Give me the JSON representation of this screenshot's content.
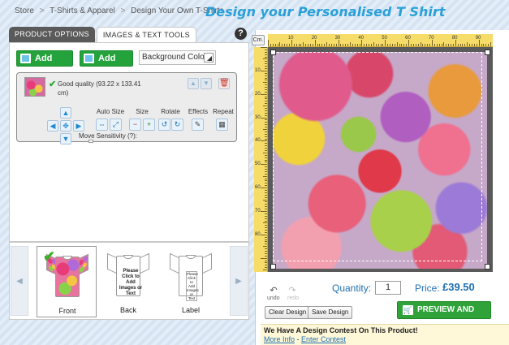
{
  "breadcrumb": {
    "items": [
      "Store",
      "T-Shirts & Apparel",
      "Design Your Own T-Shirts"
    ],
    "separator": ">"
  },
  "heading": "Design your Personalised T Shirt",
  "tabs": {
    "product_options": "PRODUCT OPTIONS",
    "images_text_tools": "IMAGES & TEXT TOOLS",
    "active": "IMAGES & TEXT TOOLS"
  },
  "help_label": "?",
  "toolbar": {
    "add_image": "Add Image",
    "add_text": "Add Text",
    "background_colour": "Background Colour"
  },
  "layer": {
    "quality_text": "Good quality (93.22 x 133.41 cm)",
    "check_glyph": "✔",
    "autosize_label": "Auto Size",
    "size_label": "Size",
    "rotate_label": "Rotate",
    "effects_label": "Effects",
    "repeat_label": "Repeat",
    "move_sensitivity": "Move Sensitivity (?):"
  },
  "views": {
    "front": "Front",
    "back": "Back",
    "label": "Label",
    "back_tee_text": "Please Click to Add Images or Text",
    "label_tee_text": "Please Click to Add Images or Text",
    "selected": "Front"
  },
  "canvas": {
    "unit_button": "Cm.",
    "ruler_top_labels": [
      "10",
      "20",
      "30",
      "40",
      "50",
      "60",
      "70",
      "80",
      "90"
    ],
    "ruler_left_labels": [
      "10",
      "20",
      "30",
      "40",
      "50",
      "60",
      "70",
      "80"
    ]
  },
  "controls": {
    "undo": "undo",
    "redo": "redo",
    "quantity_label": "Quantity:",
    "quantity_value": "1",
    "price_label": "Price:",
    "price_value": "£39.50",
    "clear_design": "Clear Design",
    "save_design": "Save Design",
    "preview_buy": "PREVIEW AND BUY"
  },
  "contest": {
    "title": "We Have A Design Contest On This Product!",
    "more_info": "More Info",
    "separator": " - ",
    "enter_contest": "Enter Contest"
  },
  "colors": {
    "accent_green": "#24a33c",
    "heading_blue": "#2aa0d8",
    "ruler_yellow": "#f6dd6a",
    "link_blue": "#1e6fb0"
  }
}
